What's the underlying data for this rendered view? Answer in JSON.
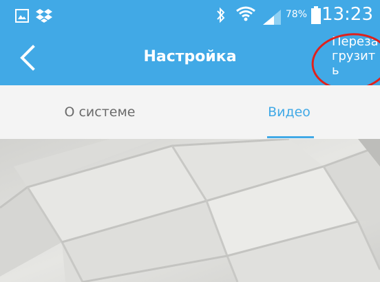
{
  "colors": {
    "accent": "#41a9e6",
    "tab_inactive": "#6b6b6b",
    "annotation": "#e0211c"
  },
  "status_bar": {
    "left_icons": [
      "gallery-icon",
      "dropbox-icon"
    ],
    "right_icons": [
      "bluetooth-icon",
      "wifi-icon",
      "signal-icon",
      "battery-icon"
    ],
    "battery": "78%",
    "time": "13:23"
  },
  "header": {
    "back_icon": "chevron-left-icon",
    "title": "Настройка",
    "reboot_label": "Перезагрузить"
  },
  "tabs": [
    {
      "label": "О системе",
      "active": false
    },
    {
      "label": "Видео",
      "active": true
    }
  ],
  "video": {
    "content": "camera-preview"
  }
}
